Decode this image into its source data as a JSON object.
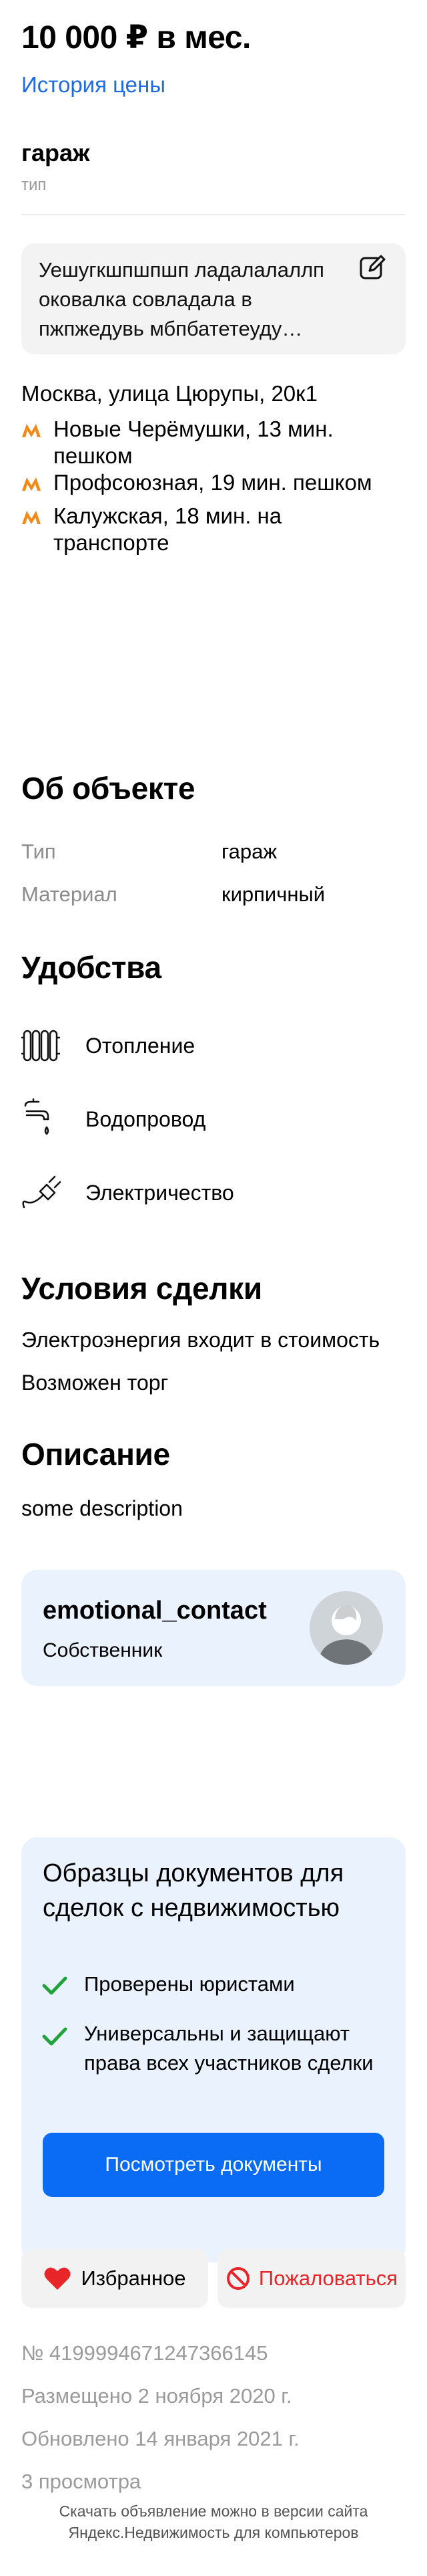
{
  "price": "10 000 ₽ в мес.",
  "price_history_link": "История цены",
  "header": {
    "type_value": "гараж",
    "type_label": "тип"
  },
  "note": {
    "text": "Уешугкшпшпшп ладалалаллп оковалка совладала в пжпжедувь мбпбатетеуду…",
    "edit_icon": "pencil-icon"
  },
  "location": {
    "address": "Москва, улица Цюрупы, 20к1",
    "metro_color": "#f28a1a",
    "metro": [
      {
        "text": "Новые Черёмушки, 13 мин. пешком"
      },
      {
        "text": "Профсоюзная, 19 мин. пешком"
      },
      {
        "text": "Калужская, 18 мин. на транспорте"
      }
    ]
  },
  "object": {
    "title": "Об объекте",
    "rows": [
      {
        "label": "Тип",
        "value": "гараж"
      },
      {
        "label": "Материал",
        "value": "кирпичный"
      }
    ]
  },
  "amenities": {
    "title": "Удобства",
    "items": [
      {
        "icon": "radiator-icon",
        "label": "Отопление"
      },
      {
        "icon": "water-tap-icon",
        "label": "Водопровод"
      },
      {
        "icon": "plug-icon",
        "label": "Электричество"
      }
    ]
  },
  "deal": {
    "title": "Условия сделки",
    "items": [
      "Электроэнергия входит в стоимость",
      "Возможен торг"
    ]
  },
  "description": {
    "title": "Описание",
    "text": "some description"
  },
  "owner": {
    "name": "emotional_contact",
    "role": "Собственник"
  },
  "docs": {
    "title": "Образцы документов для сделок с недвижимостью",
    "checks": [
      "Проверены юристами",
      "Универсальны и защищают права всех участников сделки"
    ],
    "button": "Посмотреть документы",
    "accent": "#0a6cf5",
    "check_color": "#1fa33a"
  },
  "actions": {
    "favorite": "Избранное",
    "report": "Пожаловаться",
    "report_color": "#e8262a"
  },
  "meta": {
    "id": "№ 4199994671247366145",
    "posted": "Размещено 2 ноября 2020 г.",
    "updated": "Обновлено 14 января 2021 г.",
    "views": "3 просмотра"
  },
  "footer": {
    "line1": "Скачать объявление можно в версии сайта",
    "line2": "Яндекс.Недвижимость для компьютеров"
  }
}
